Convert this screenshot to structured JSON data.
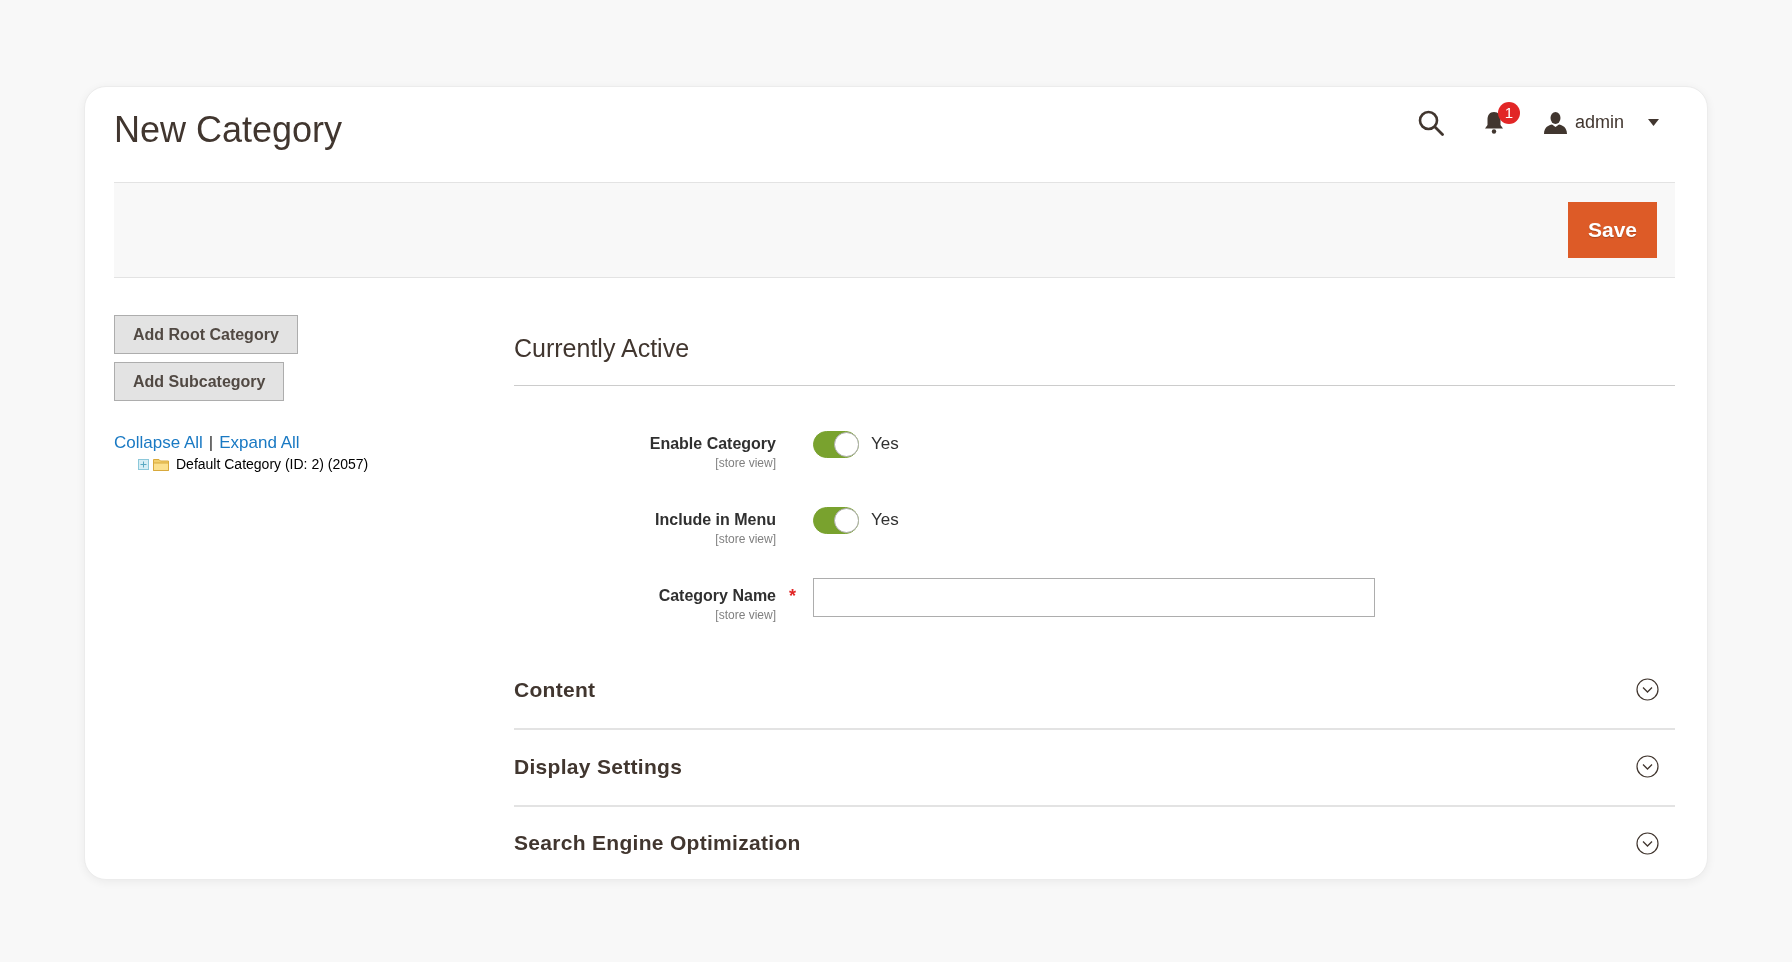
{
  "header": {
    "title": "New Category",
    "notification_count": "1",
    "user": "admin"
  },
  "action_bar": {
    "buttons": [
      {
        "label": "Save",
        "kind": "primary"
      }
    ]
  },
  "sidebar": {
    "buttons": [
      "Add Root Category",
      "Add Subcategory"
    ],
    "tree_links": [
      "Collapse All",
      "Expand All"
    ],
    "tree_link_separator": "|",
    "tree": [
      {
        "label": "Default Category (ID: 2) (2057)",
        "expanded": false
      }
    ]
  },
  "form": {
    "heading": "Currently Active",
    "fields": [
      {
        "kind": "toggle",
        "label": "Enable Category",
        "scope": "[store view]",
        "on": true,
        "value": "Yes"
      },
      {
        "kind": "toggle",
        "label": "Include in Menu",
        "scope": "[store view]",
        "on": true,
        "value": "Yes"
      },
      {
        "kind": "text",
        "label": "Category Name",
        "scope": "[store view]",
        "required_mark": "*"
      }
    ]
  },
  "sections": [
    {
      "title": "Content",
      "expanded": false
    },
    {
      "title": "Display Settings",
      "expanded": false
    },
    {
      "title": "Search Engine Optimization",
      "expanded": false
    }
  ]
}
